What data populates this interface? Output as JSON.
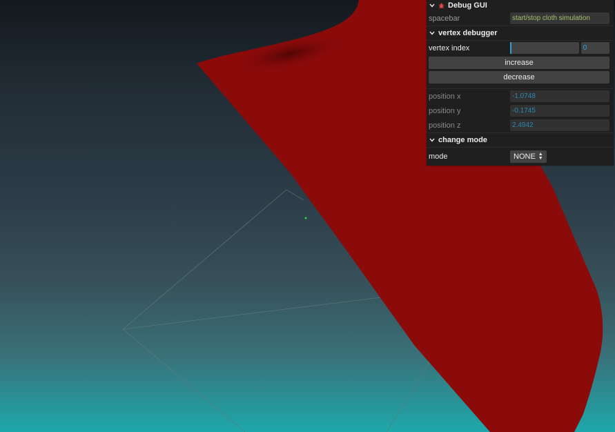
{
  "gui": {
    "title": "Debug GUI",
    "controls": {
      "spacebar_label": "spacebar",
      "spacebar_value": "start/stop cloth simulation"
    },
    "vertex_folder": {
      "title": "vertex debugger",
      "index_label": "vertex index",
      "index_value": "0",
      "increase_label": "increase",
      "decrease_label": "decrease",
      "position_x_label": "position x",
      "position_x_value": "-1.0748",
      "position_y_label": "position y",
      "position_y_value": "-0.1745",
      "position_z_label": "position z",
      "position_z_value": "2.4942"
    },
    "mode_folder": {
      "title": "change mode",
      "mode_label": "mode",
      "mode_value": "NONE"
    }
  },
  "colors": {
    "cloth": "#8b0a0a",
    "accent_number": "#2fa1d6",
    "accent_string": "#a5c06a",
    "panel_bg": "#1f1f1f",
    "sky_bottom": "#1ea8ab"
  },
  "icons": {
    "title": "bug-icon",
    "folder": "chevron-down-icon"
  }
}
